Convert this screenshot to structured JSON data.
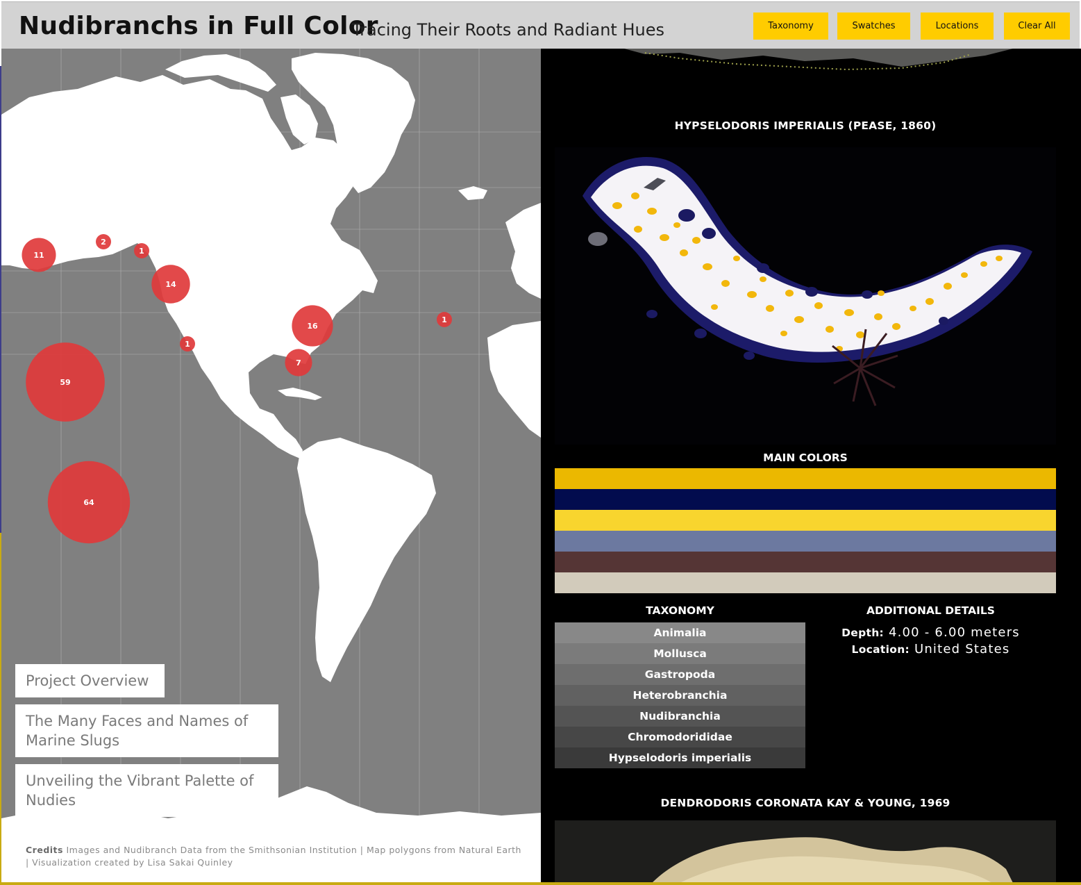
{
  "header": {
    "title": "Nudibranchs in Full Color",
    "subtitle": "Tracing Their Roots and Radiant Hues",
    "buttons": [
      "Taxonomy",
      "Swatches",
      "Locations",
      "Clear All"
    ]
  },
  "map": {
    "bubbles": [
      {
        "label": "11",
        "count": 11
      },
      {
        "label": "2",
        "count": 2
      },
      {
        "label": "1",
        "count": 1
      },
      {
        "label": "14",
        "count": 14
      },
      {
        "label": "16",
        "count": 16
      },
      {
        "label": "1",
        "count": 1
      },
      {
        "label": "1",
        "count": 1
      },
      {
        "label": "7",
        "count": 7
      },
      {
        "label": "59",
        "count": 59
      },
      {
        "label": "64",
        "count": 64
      }
    ],
    "bubble_color": "#e0393b"
  },
  "stories": {
    "overview": "Project Overview",
    "faces": "The Many Faces and Names of Marine Slugs",
    "palette": "Unveiling the Vibrant Palette of Nudies"
  },
  "credits": {
    "label": "Credits",
    "text": "Images and Nudibranch Data from the Smithsonian Institution | Map polygons from Natural Earth | Visualization created by Lisa Sakai Quinley"
  },
  "specimen": {
    "name": "HYPSELODORIS IMPERIALIS (PEASE, 1860)",
    "colors_title": "MAIN COLORS",
    "main_colors": [
      "#ebb800",
      "#020c4e",
      "#f8d52e",
      "#6c79a0",
      "#553535",
      "#d2cbbb"
    ],
    "taxonomy_title": "TAXONOMY",
    "taxonomy": [
      "Animalia",
      "Mollusca",
      "Gastropoda",
      "Heterobranchia",
      "Nudibranchia",
      "Chromodorididae",
      "Hypselodoris imperialis"
    ],
    "details_title": "ADDITIONAL DETAILS",
    "depth_label": "Depth:",
    "depth_value": "4.00 - 6.00 meters",
    "location_label": "Location:",
    "location_value": "United States"
  },
  "next_specimen": {
    "name": "DENDRODORIS CORONATA KAY & YOUNG, 1969"
  }
}
